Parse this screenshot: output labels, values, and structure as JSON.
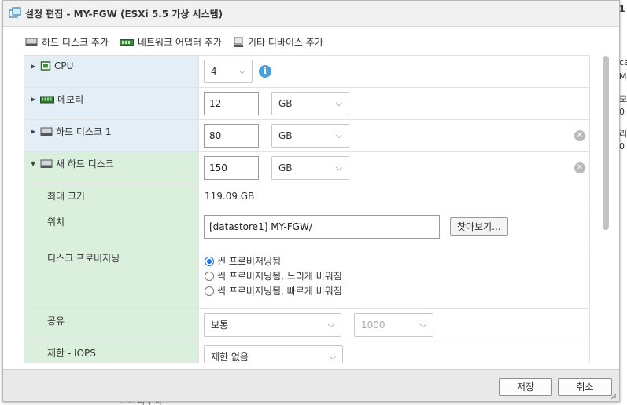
{
  "dialog": {
    "title": "설정 편집 - MY-FGW (ESXi 5.5 가상 시스템)"
  },
  "toolbar": {
    "add_hard_disk": "하드 디스크 추가",
    "add_network_adapter": "네트워크 어댑터 추가",
    "add_other_device": "기타 디바이스 추가"
  },
  "rows": {
    "cpu": {
      "label": "CPU",
      "value": "4"
    },
    "memory": {
      "label": "메모리",
      "value": "12",
      "unit": "GB"
    },
    "hard_disk_1": {
      "label": "하드 디스크 1",
      "value": "80",
      "unit": "GB"
    },
    "new_hard_disk": {
      "label": "새 하드 디스크",
      "value": "150",
      "unit": "GB"
    },
    "max_size": {
      "label": "최대 크기",
      "value": "119.09 GB"
    },
    "location": {
      "label": "위치",
      "value": "[datastore1] MY-FGW/",
      "browse": "찾아보기..."
    },
    "provisioning": {
      "label": "디스크 프로비저닝",
      "options": [
        "씬 프로비저닝됨",
        "씩 프로비저닝됨, 느리게 비워짐",
        "씩 프로비저닝됨, 빠르게 비워짐"
      ],
      "selected_index": 0
    },
    "shares": {
      "label": "공유",
      "value": "보통",
      "amount": "1000"
    },
    "limit_iops": {
      "label": "제한 - IOPS",
      "value": "제한 없음"
    }
  },
  "footer": {
    "save": "저장",
    "cancel": "취소"
  },
  "background": {
    "right_edge_chars": [
      "1",
      "ca",
      "MH",
      "모",
      "0",
      "리",
      "0"
    ],
    "bottom_fragment": "ㄷ ㄷ 니 위치"
  },
  "colors": {
    "header_row_blue": "#e4eef6",
    "new_disk_green": "#dbefdd",
    "info_blue": "#4a9fdc"
  }
}
